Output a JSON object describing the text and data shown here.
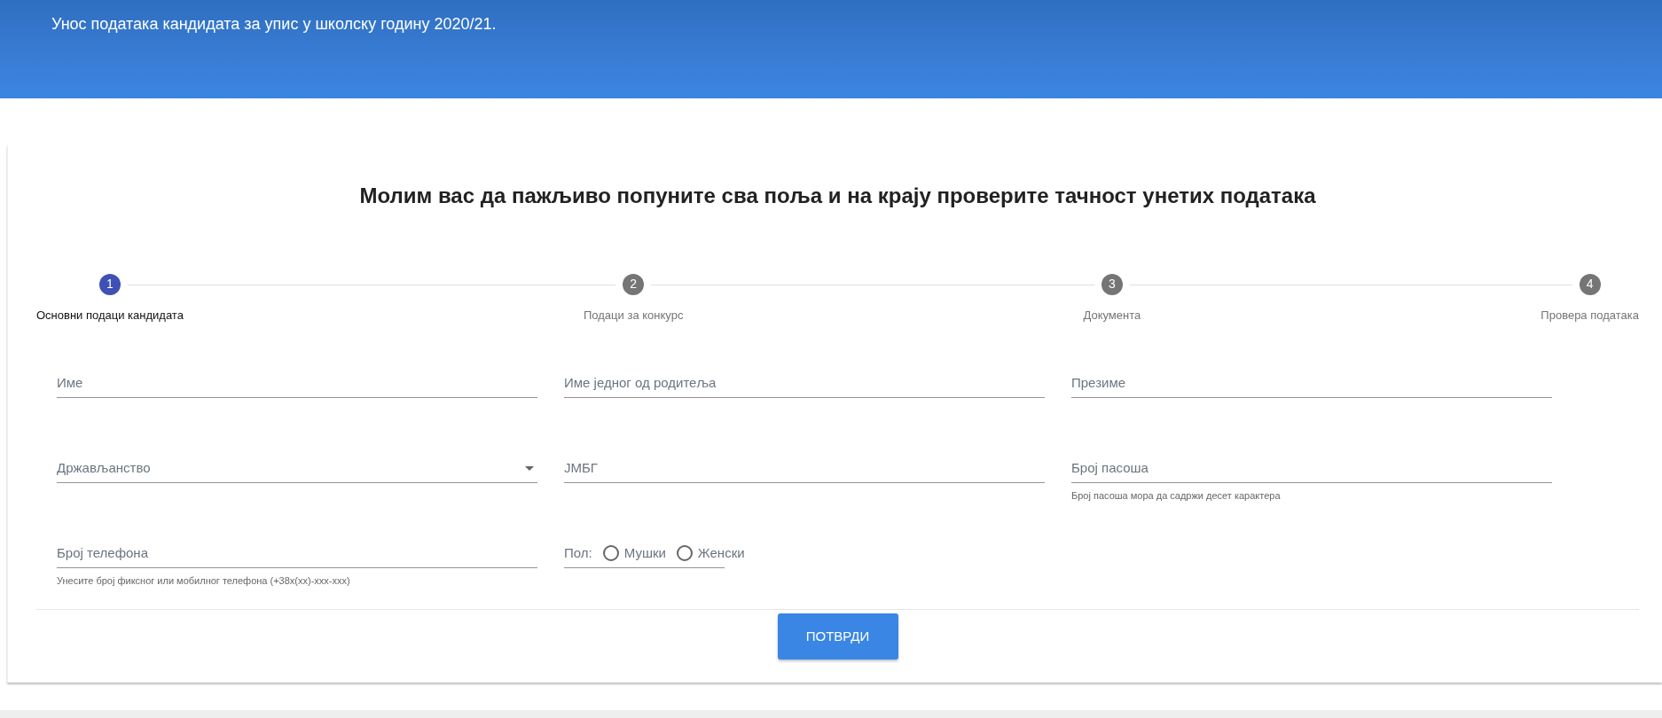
{
  "header": {
    "title": "Унос података кандидата за упис у школску годину 2020/21."
  },
  "heading": "Молим вас да пажљиво попуните сва поља и на крају проверите тачност унетих података",
  "steps": [
    {
      "number": "1",
      "label": "Основни подаци кандидата",
      "selected": true
    },
    {
      "number": "2",
      "label": "Подаци за конкурс",
      "selected": false
    },
    {
      "number": "3",
      "label": "Документа",
      "selected": false
    },
    {
      "number": "4",
      "label": "Провера података",
      "selected": false
    }
  ],
  "fields": [
    {
      "kind": "text",
      "placeholder": "Име"
    },
    {
      "kind": "text",
      "placeholder": "Име једног од родитеља"
    },
    {
      "kind": "text",
      "placeholder": "Презиме"
    },
    {
      "kind": "select",
      "placeholder": "Држављанство"
    },
    {
      "kind": "text",
      "placeholder": "ЈМБГ"
    },
    {
      "kind": "text",
      "placeholder": "Број пасоша",
      "hint": "Број пасоша мора да садржи десет карактера"
    },
    {
      "kind": "text",
      "placeholder": "Број телефона",
      "hint": "Унесите број фиксног или мобилног телефона (+38x(xx)-xxx-xxx)"
    },
    {
      "kind": "radio",
      "label": "Пол:",
      "options": [
        {
          "label": "Мушки",
          "selected": false
        },
        {
          "label": "Женски",
          "selected": false
        }
      ]
    }
  ],
  "submit_button": "ПОТВРДИ"
}
